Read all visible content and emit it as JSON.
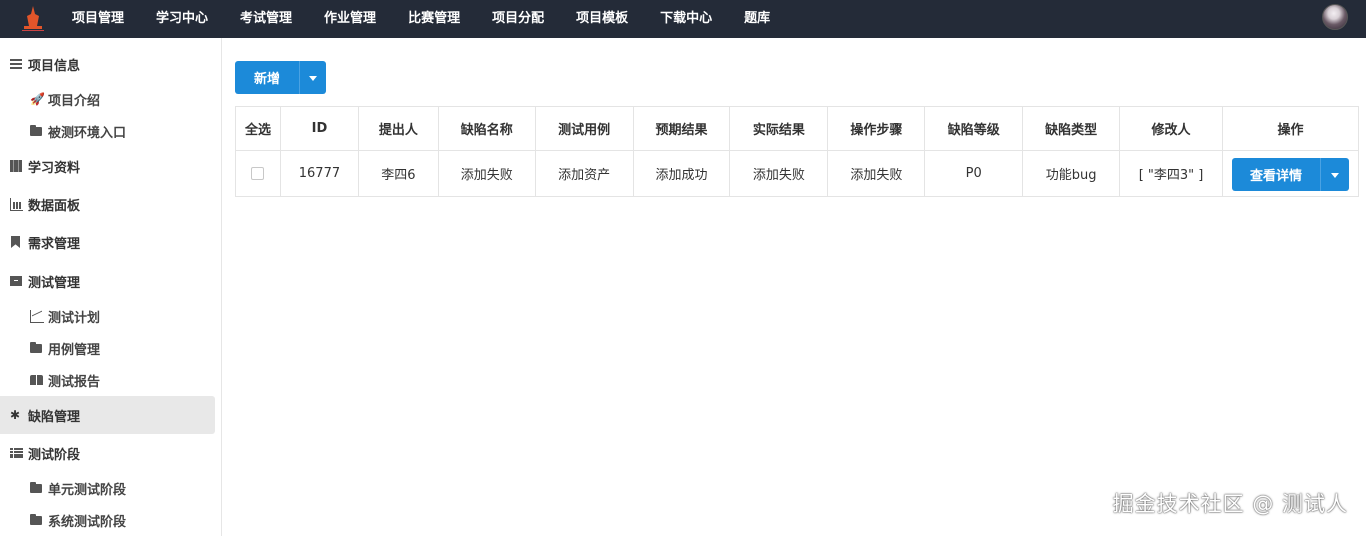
{
  "nav": {
    "items": [
      "项目管理",
      "学习中心",
      "考试管理",
      "作业管理",
      "比赛管理",
      "项目分配",
      "项目模板",
      "下载中心",
      "题库"
    ]
  },
  "sidebar": {
    "items": [
      {
        "label": "项目信息",
        "icon": "list-icon",
        "level": 1
      },
      {
        "label": "项目介绍",
        "icon": "rocket-icon",
        "level": 2
      },
      {
        "label": "被测环境入口",
        "icon": "folder-icon",
        "level": 2
      },
      {
        "label": "学习资料",
        "icon": "map-icon",
        "level": 1
      },
      {
        "label": "数据面板",
        "icon": "bar-chart-icon",
        "level": 1
      },
      {
        "label": "需求管理",
        "icon": "bookmark-icon",
        "level": 1
      },
      {
        "label": "测试管理",
        "icon": "archive-icon",
        "level": 1
      },
      {
        "label": "测试计划",
        "icon": "line-chart-icon",
        "level": 2
      },
      {
        "label": "用例管理",
        "icon": "folder-icon",
        "level": 2
      },
      {
        "label": "测试报告",
        "icon": "book-icon",
        "level": 2
      },
      {
        "label": "缺陷管理",
        "icon": "bug-icon",
        "level": 1,
        "active": true
      },
      {
        "label": "测试阶段",
        "icon": "th-list-icon",
        "level": 1
      },
      {
        "label": "单元测试阶段",
        "icon": "folder-icon",
        "level": 2
      },
      {
        "label": "系统测试阶段",
        "icon": "folder-icon",
        "level": 2
      }
    ]
  },
  "toolbar": {
    "add_label": "新增"
  },
  "table": {
    "headers": [
      "全选",
      "ID",
      "提出人",
      "缺陷名称",
      "测试用例",
      "预期结果",
      "实际结果",
      "操作步骤",
      "缺陷等级",
      "缺陷类型",
      "修改人",
      "操作"
    ],
    "rows": [
      {
        "id": "16777",
        "reporter": "李四6",
        "defect_name": "添加失败",
        "test_case": "添加资产",
        "expected": "添加成功",
        "actual": "添加失败",
        "steps": "添加失败",
        "level": "P0",
        "type": "功能bug",
        "modifier": "[ \"李四3\" ]",
        "action_label": "查看详情"
      }
    ]
  },
  "watermark": "掘金技术社区 @ 测试人",
  "colors": {
    "navbar": "#242b38",
    "primary": "#1c8ad9",
    "active_bg": "#e8e8e8"
  }
}
